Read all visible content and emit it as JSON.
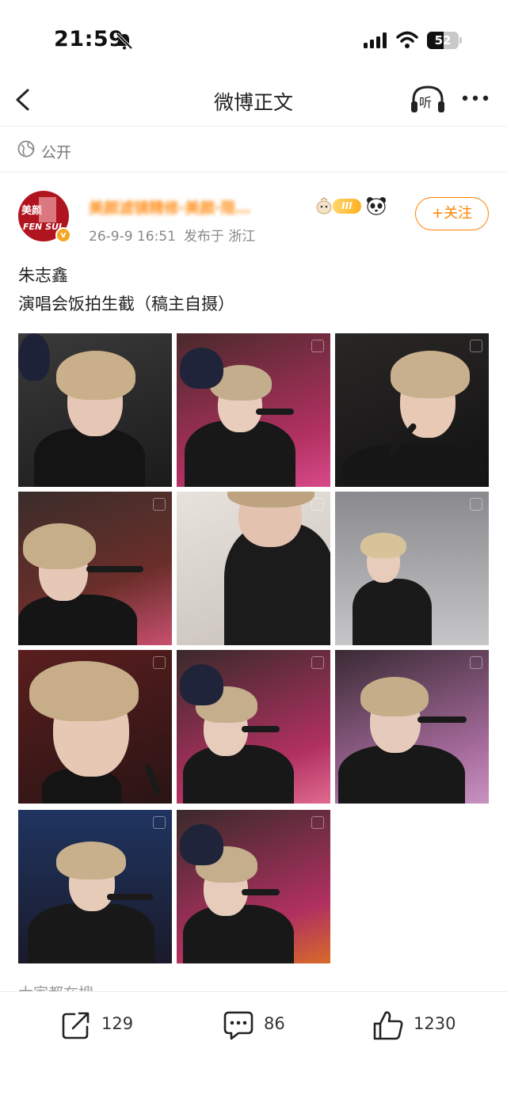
{
  "status_bar": {
    "time": "21:59",
    "battery_percent": 52,
    "battery_label": "52"
  },
  "nav": {
    "title": "微博正文",
    "listen_label": "听"
  },
  "visibility": {
    "label": "公开"
  },
  "post": {
    "avatar_text_top": "美颜",
    "avatar_text_bottom": "FEN SUI",
    "username": "美颜滤镜精修·美颜·限…",
    "level_badge": "III",
    "timestamp": "26-9-9 16:51",
    "location": "发布于 浙江",
    "follow_label": "+关注",
    "text_line_1": "朱志鑫",
    "text_line_2": "演唱会饭拍生截（稿主自摄）",
    "image_count": 11
  },
  "trending_label": "大家都在搜",
  "actions": {
    "repost_count": "129",
    "comment_count": "86",
    "like_count": "1230"
  },
  "colors": {
    "accent": "#ff8200",
    "avatar_red": "#b0151f"
  }
}
